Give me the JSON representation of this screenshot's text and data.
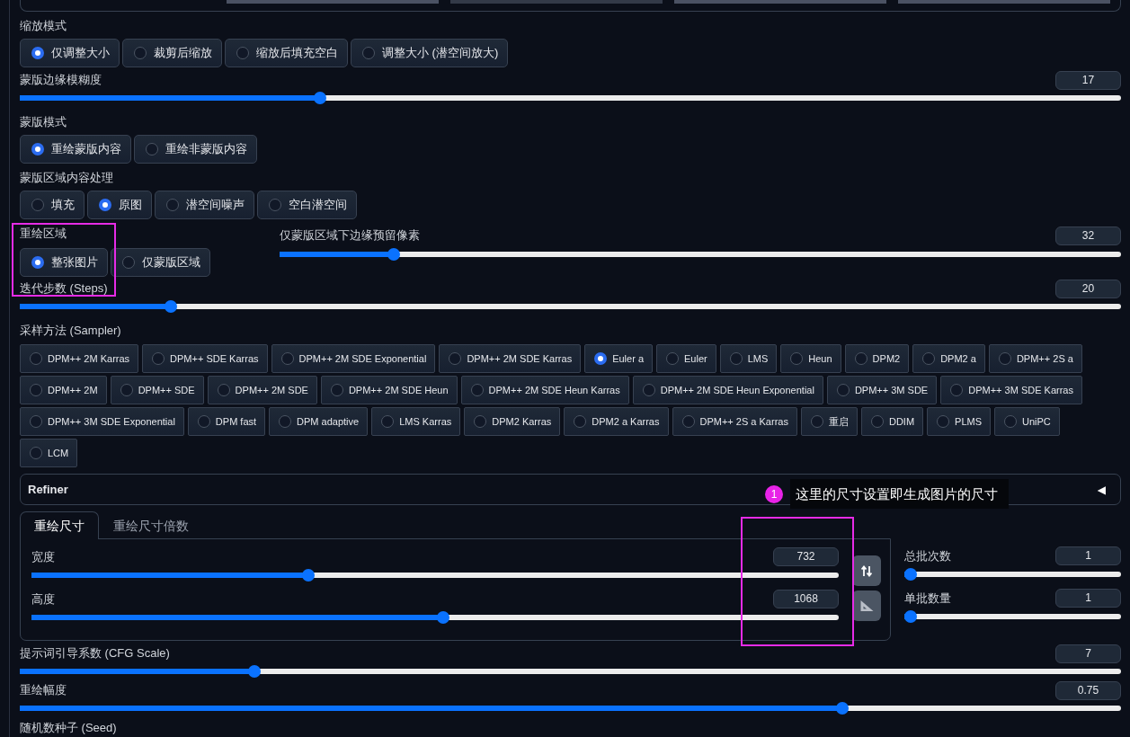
{
  "resize_mode": {
    "label": "缩放模式",
    "options": [
      {
        "label": "仅调整大小",
        "selected": true
      },
      {
        "label": "裁剪后缩放",
        "selected": false
      },
      {
        "label": "缩放后填充空白",
        "selected": false
      },
      {
        "label": "调整大小 (潜空间放大)",
        "selected": false
      }
    ]
  },
  "mask_blur": {
    "label": "蒙版边缘模糊度",
    "value": "17",
    "level": 0.27
  },
  "mask_mode": {
    "label": "蒙版模式",
    "options": [
      {
        "label": "重绘蒙版内容",
        "selected": true
      },
      {
        "label": "重绘非蒙版内容",
        "selected": false
      }
    ]
  },
  "masked_content": {
    "label": "蒙版区域内容处理",
    "options": [
      {
        "label": "填充",
        "selected": false
      },
      {
        "label": "原图",
        "selected": true
      },
      {
        "label": "潜空间噪声",
        "selected": false
      },
      {
        "label": "空白潜空间",
        "selected": false
      }
    ]
  },
  "inpaint_area": {
    "label": "重绘区域",
    "highlighted": true,
    "options": [
      {
        "label": "整张图片",
        "selected": true
      },
      {
        "label": "仅蒙版区域",
        "selected": false
      }
    ]
  },
  "only_masked_padding": {
    "label": "仅蒙版区域下边缘预留像素",
    "value": "32",
    "level": 0.13
  },
  "steps": {
    "label": "迭代步数 (Steps)",
    "value": "20",
    "level": 0.133
  },
  "sampler": {
    "label": "采样方法 (Sampler)",
    "options": [
      {
        "label": "DPM++ 2M Karras",
        "selected": false
      },
      {
        "label": "DPM++ SDE Karras",
        "selected": false
      },
      {
        "label": "DPM++ 2M SDE Exponential",
        "selected": false
      },
      {
        "label": "DPM++ 2M SDE Karras",
        "selected": false
      },
      {
        "label": "Euler a",
        "selected": true
      },
      {
        "label": "Euler",
        "selected": false
      },
      {
        "label": "LMS",
        "selected": false
      },
      {
        "label": "Heun",
        "selected": false
      },
      {
        "label": "DPM2",
        "selected": false
      },
      {
        "label": "DPM2 a",
        "selected": false
      },
      {
        "label": "DPM++ 2S a",
        "selected": false
      },
      {
        "label": "DPM++ 2M",
        "selected": false
      },
      {
        "label": "DPM++ SDE",
        "selected": false
      },
      {
        "label": "DPM++ 2M SDE",
        "selected": false
      },
      {
        "label": "DPM++ 2M SDE Heun",
        "selected": false
      },
      {
        "label": "DPM++ 2M SDE Heun Karras",
        "selected": false
      },
      {
        "label": "DPM++ 2M SDE Heun Exponential",
        "selected": false
      },
      {
        "label": "DPM++ 3M SDE",
        "selected": false
      },
      {
        "label": "DPM++ 3M SDE Karras",
        "selected": false
      },
      {
        "label": "DPM++ 3M SDE Exponential",
        "selected": false
      },
      {
        "label": "DPM fast",
        "selected": false
      },
      {
        "label": "DPM adaptive",
        "selected": false
      },
      {
        "label": "LMS Karras",
        "selected": false
      },
      {
        "label": "DPM2 Karras",
        "selected": false
      },
      {
        "label": "DPM2 a Karras",
        "selected": false
      },
      {
        "label": "DPM++ 2S a Karras",
        "selected": false
      },
      {
        "label": "重启",
        "selected": false
      },
      {
        "label": "DDIM",
        "selected": false
      },
      {
        "label": "PLMS",
        "selected": false
      },
      {
        "label": "UniPC",
        "selected": false
      },
      {
        "label": "LCM",
        "selected": false
      }
    ]
  },
  "refiner": {
    "label": "Refiner",
    "toggle": "◀"
  },
  "callout": {
    "number": "1",
    "text": "这里的尺寸设置即生成图片的尺寸"
  },
  "size_tabs": [
    {
      "label": "重绘尺寸",
      "selected": true
    },
    {
      "label": "重绘尺寸倍数",
      "selected": false
    }
  ],
  "size": {
    "highlighted": true,
    "sliders": [
      {
        "label": "宽度",
        "value": "732",
        "level": 0.34
      },
      {
        "label": "高度",
        "value": "1068",
        "level": 0.51
      }
    ]
  },
  "batch": [
    {
      "label": "总批次数",
      "value": "1",
      "level": 0
    },
    {
      "label": "单批数量",
      "value": "1",
      "level": 0
    }
  ],
  "cfg_scale": {
    "label": "提示词引导系数 (CFG Scale)",
    "value": "7",
    "level": 0.21
  },
  "denoising": {
    "label": "重绘幅度",
    "value": "0.75",
    "level": 0.75
  },
  "seed": {
    "label": "随机数种子 (Seed)"
  }
}
